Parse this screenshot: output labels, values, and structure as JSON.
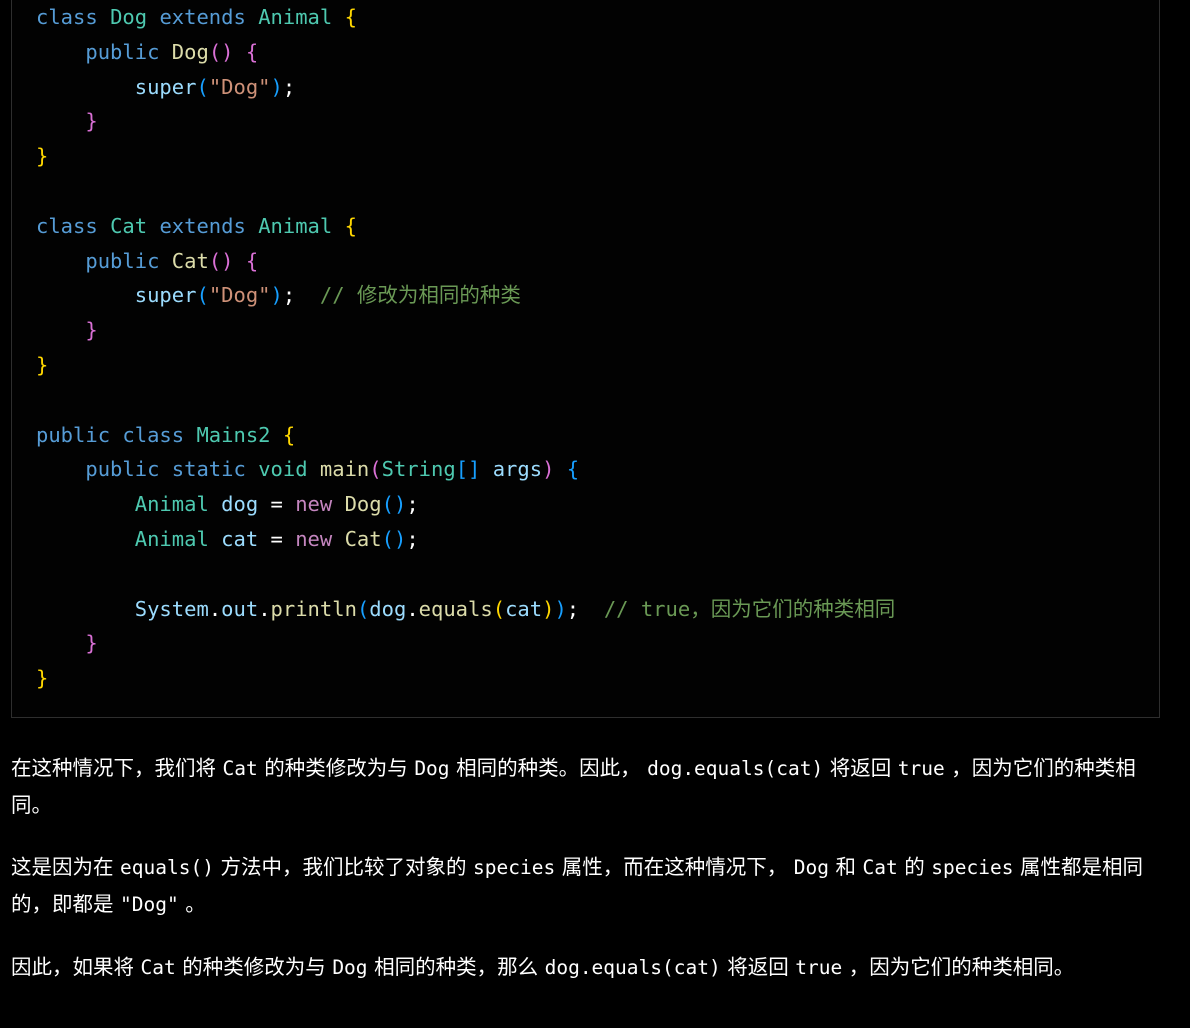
{
  "theme": {
    "background": "#000000",
    "code_background": "#020202",
    "code_border": "#2e2e2e",
    "text": "#ffffff",
    "keyword": "#569cd6",
    "type": "#4ec9b0",
    "function": "#dcdcaa",
    "variable": "#9cdcfe",
    "string": "#ce9178",
    "comment": "#6a9955",
    "new_keyword": "#c586c0",
    "bracket_1": "#ffd700",
    "bracket_2": "#da70d6",
    "bracket_3": "#179fff"
  },
  "code_block": {
    "language": "java",
    "lines": [
      "class Dog extends Animal {",
      "    public Dog() {",
      "        super(\"Dog\");",
      "    }",
      "}",
      "",
      "class Cat extends Animal {",
      "    public Cat() {",
      "        super(\"Dog\");  // 修改为相同的种类",
      "    }",
      "}",
      "",
      "public class Mains2 {",
      "    public static void main(String[] args) {",
      "        Animal dog = new Dog();",
      "        Animal cat = new Cat();",
      "",
      "        System.out.println(dog.equals(cat));  // true，因为它们的种类相同",
      "    }",
      "}"
    ],
    "tokens": {
      "kw_class": "class",
      "kw_public": "public",
      "kw_static": "static",
      "kw_extends": "extends",
      "kw_void": "void",
      "kw_new": "new",
      "type_dog": "Dog",
      "type_cat": "Cat",
      "type_animal": "Animal",
      "type_string": "String",
      "type_mains2": "Mains2",
      "fn_main": "main",
      "fn_super": "super",
      "fn_println": "println",
      "fn_equals": "equals",
      "var_args": "args",
      "var_dog": "dog",
      "var_cat": "cat",
      "var_system": "System",
      "var_out": "out",
      "str_dog": "\"Dog\"",
      "comment_cat": "// 修改为相同的种类",
      "comment_println": "// true，因为它们的种类相同"
    }
  },
  "prose": {
    "paragraphs": [
      {
        "id": "p1",
        "parts": [
          {
            "type": "text",
            "value": "在这种情况下，我们将 "
          },
          {
            "type": "code",
            "value": "Cat"
          },
          {
            "type": "text",
            "value": " 的种类修改为与 "
          },
          {
            "type": "code",
            "value": "Dog"
          },
          {
            "type": "text",
            "value": " 相同的种类。因此， "
          },
          {
            "type": "code",
            "value": "dog.equals(cat)"
          },
          {
            "type": "text",
            "value": " 将返回 "
          },
          {
            "type": "code",
            "value": "true"
          },
          {
            "type": "text",
            "value": " ，因为它们的种类相同。"
          }
        ]
      },
      {
        "id": "p2",
        "parts": [
          {
            "type": "text",
            "value": "这是因为在 "
          },
          {
            "type": "code",
            "value": "equals()"
          },
          {
            "type": "text",
            "value": " 方法中，我们比较了对象的 "
          },
          {
            "type": "code",
            "value": "species"
          },
          {
            "type": "text",
            "value": " 属性，而在这种情况下， "
          },
          {
            "type": "code",
            "value": "Dog"
          },
          {
            "type": "text",
            "value": " 和 "
          },
          {
            "type": "code",
            "value": "Cat"
          },
          {
            "type": "text",
            "value": " 的 "
          },
          {
            "type": "code",
            "value": "species"
          },
          {
            "type": "text",
            "value": " 属性都是相同的，即都是 "
          },
          {
            "type": "code",
            "value": "\"Dog\""
          },
          {
            "type": "text",
            "value": " 。"
          }
        ]
      },
      {
        "id": "p3",
        "parts": [
          {
            "type": "text",
            "value": "因此，如果将 "
          },
          {
            "type": "code",
            "value": "Cat"
          },
          {
            "type": "text",
            "value": " 的种类修改为与 "
          },
          {
            "type": "code",
            "value": "Dog"
          },
          {
            "type": "text",
            "value": " 相同的种类，那么 "
          },
          {
            "type": "code",
            "value": "dog.equals(cat)"
          },
          {
            "type": "text",
            "value": " 将返回 "
          },
          {
            "type": "code",
            "value": "true"
          },
          {
            "type": "text",
            "value": " ，因为它们的种类相同。"
          }
        ]
      }
    ]
  }
}
